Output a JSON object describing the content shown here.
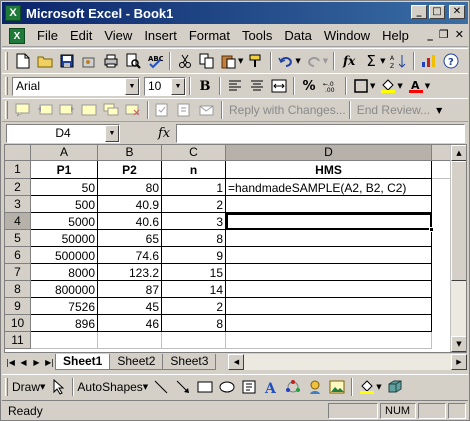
{
  "window": {
    "title": "Microsoft Excel - Book1"
  },
  "menu": [
    "File",
    "Edit",
    "View",
    "Insert",
    "Format",
    "Tools",
    "Data",
    "Window",
    "Help"
  ],
  "font": {
    "name": "Arial",
    "size": "10"
  },
  "review": {
    "reply_label": "Reply with Changes...",
    "end_label": "End Review..."
  },
  "namebox": "D4",
  "fx_label": "fx",
  "columns": [
    "A",
    "B",
    "C",
    "D"
  ],
  "rows": [
    "1",
    "2",
    "3",
    "4",
    "5",
    "6",
    "7",
    "8",
    "9",
    "10",
    "11"
  ],
  "headers": {
    "a": "P1",
    "b": "P2",
    "c": "n",
    "d": "HMS"
  },
  "data": [
    {
      "a": "50",
      "b": "80",
      "c": "1",
      "d": "=handmadeSAMPLE(A2, B2, C2)"
    },
    {
      "a": "500",
      "b": "40.9",
      "c": "2",
      "d": ""
    },
    {
      "a": "5000",
      "b": "40.6",
      "c": "3",
      "d": ""
    },
    {
      "a": "50000",
      "b": "65",
      "c": "8",
      "d": ""
    },
    {
      "a": "500000",
      "b": "74.6",
      "c": "9",
      "d": ""
    },
    {
      "a": "8000",
      "b": "123.2",
      "c": "15",
      "d": ""
    },
    {
      "a": "800000",
      "b": "87",
      "c": "14",
      "d": ""
    },
    {
      "a": "7526",
      "b": "45",
      "c": "2",
      "d": ""
    },
    {
      "a": "896",
      "b": "46",
      "c": "8",
      "d": ""
    }
  ],
  "sheets": [
    "Sheet1",
    "Sheet2",
    "Sheet3"
  ],
  "draw": {
    "draw_label": "Draw",
    "autoshapes_label": "AutoShapes"
  },
  "status": {
    "text": "Ready",
    "num": "NUM"
  }
}
